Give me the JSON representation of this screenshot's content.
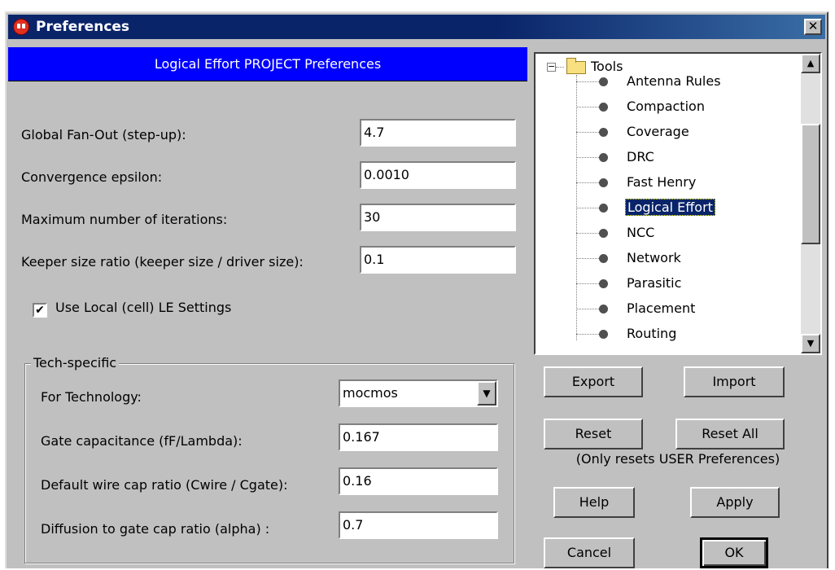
{
  "window": {
    "title": "Preferences",
    "close_glyph": "✕"
  },
  "panel": {
    "header": "Logical Effort PROJECT Preferences",
    "fields": [
      {
        "label": "Global Fan-Out (step-up):",
        "value": "4.7"
      },
      {
        "label": "Convergence epsilon:",
        "value": "0.0010"
      },
      {
        "label": "Maximum number of iterations:",
        "value": "30"
      },
      {
        "label": "Keeper size ratio (keeper size / driver size):",
        "value": "0.1"
      }
    ],
    "use_local": {
      "label": "Use Local (cell) LE Settings",
      "checked": true,
      "mark": "✔"
    },
    "tech": {
      "legend": "Tech-specific",
      "technology": {
        "label": "For Technology:",
        "value": "mocmos",
        "arrow": "▼"
      },
      "fields": [
        {
          "label": "Gate capacitance (fF/Lambda):",
          "value": "0.167"
        },
        {
          "label": "Default wire cap ratio (Cwire / Cgate):",
          "value": "0.16"
        },
        {
          "label": "Diffusion to gate cap ratio (alpha) :",
          "value": "0.7"
        }
      ]
    }
  },
  "tree": {
    "root": {
      "label": "Tools",
      "expand_glyph": "−"
    },
    "items": [
      {
        "label": "Antenna Rules"
      },
      {
        "label": "Compaction"
      },
      {
        "label": "Coverage"
      },
      {
        "label": "DRC"
      },
      {
        "label": "Fast Henry"
      },
      {
        "label": "Logical Effort",
        "selected": true
      },
      {
        "label": "NCC"
      },
      {
        "label": "Network"
      },
      {
        "label": "Parasitic"
      },
      {
        "label": "Placement"
      },
      {
        "label": "Routing"
      }
    ],
    "scroll_up_glyph": "▲",
    "scroll_down_glyph": "▼"
  },
  "buttons": {
    "export": "Export",
    "import": "Import",
    "reset": "Reset",
    "reset_all": "Reset All",
    "reset_note": "(Only resets USER Preferences)",
    "help": "Help",
    "apply": "Apply",
    "cancel": "Cancel",
    "ok": "OK"
  },
  "colors": {
    "header_blue": "#0000ff",
    "selection": "#0a246a",
    "face": "#c0c0c0"
  }
}
